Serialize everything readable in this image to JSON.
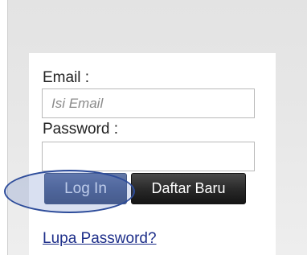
{
  "form": {
    "email_label": "Email :",
    "email_placeholder": "Isi Email",
    "email_value": "",
    "password_label": "Password :",
    "password_value": "",
    "login_button": "Log In",
    "register_button": "Daftar Baru",
    "forgot_password_link": "Lupa Password?"
  },
  "colors": {
    "login_button": "#4e6291",
    "register_button": "#2a2a2a",
    "link": "#1e2f8a",
    "highlight": "#2d4c9a"
  }
}
